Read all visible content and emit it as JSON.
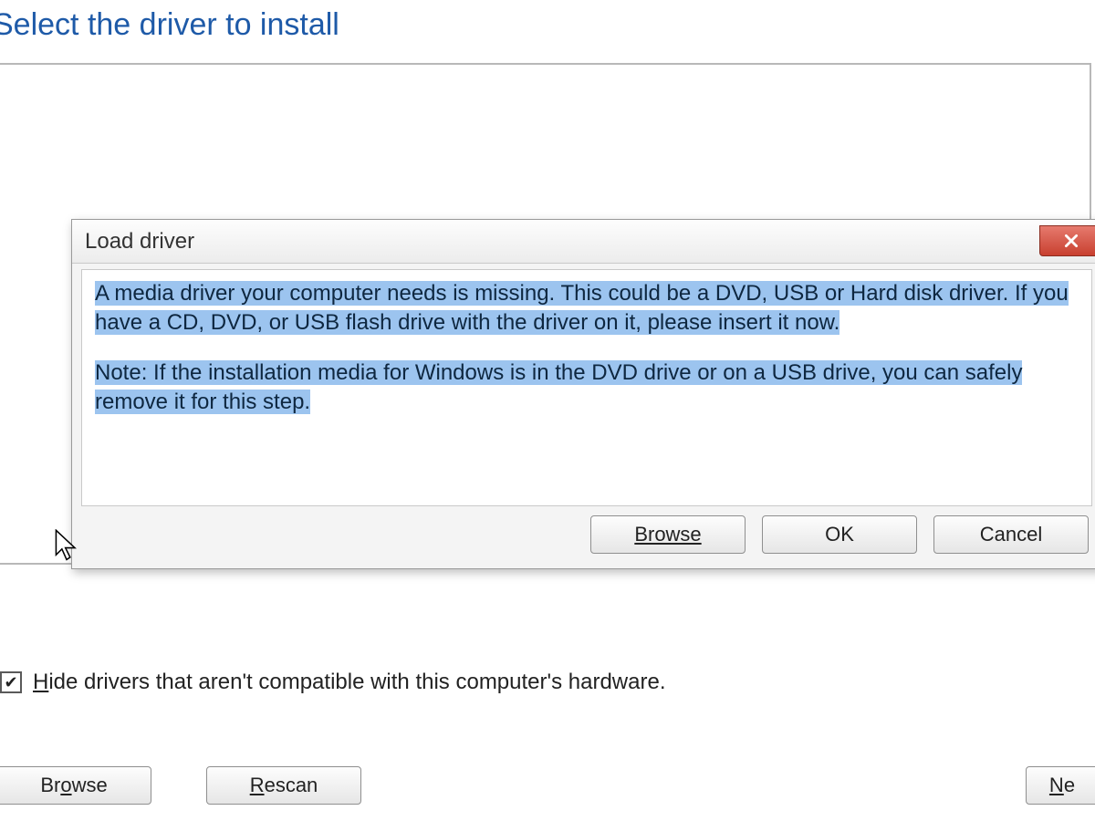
{
  "page": {
    "title": "Select the driver to install"
  },
  "dialog": {
    "title": "Load driver",
    "message1": "A media driver your computer needs is missing. This could be a DVD, USB or Hard disk driver. If you have a CD, DVD, or USB flash drive with the driver on it, please insert it now.",
    "message2": "Note: If the installation media for Windows is in the DVD drive or on a USB drive, you can safely remove it for this step.",
    "buttons": {
      "browse": "Browse",
      "ok": "OK",
      "cancel": "Cancel"
    }
  },
  "checkbox": {
    "checked": true,
    "label_pre": "H",
    "label_rest": "ide drivers that aren't compatible with this computer's hardware."
  },
  "bottom": {
    "browse_pre": "Br",
    "browse_u": "o",
    "browse_post": "wse",
    "rescan_u": "R",
    "rescan_post": "escan",
    "next_u": "N",
    "next_post": "e"
  }
}
